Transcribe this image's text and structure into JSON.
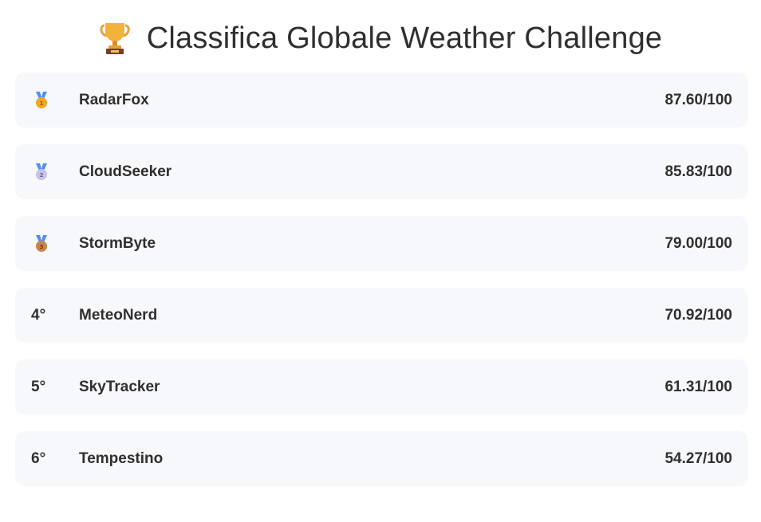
{
  "header": {
    "title": "Classifica Globale Weather Challenge",
    "icon": "trophy-icon"
  },
  "leaderboard": [
    {
      "rank": "",
      "medal": "gold",
      "name": "RadarFox",
      "score": "87.60/100"
    },
    {
      "rank": "",
      "medal": "silver",
      "name": "CloudSeeker",
      "score": "85.83/100"
    },
    {
      "rank": "",
      "medal": "bronze",
      "name": "StormByte",
      "score": "79.00/100"
    },
    {
      "rank": "4°",
      "medal": "",
      "name": "MeteoNerd",
      "score": "70.92/100"
    },
    {
      "rank": "5°",
      "medal": "",
      "name": "SkyTracker",
      "score": "61.31/100"
    },
    {
      "rank": "6°",
      "medal": "",
      "name": "Tempestino",
      "score": "54.27/100"
    }
  ],
  "colors": {
    "row_background": "#f7f8fb",
    "text": "#2f2f2f",
    "gold": "#f5a524",
    "silver": "#c9c2e6",
    "bronze": "#c8824e",
    "ribbon": "#4f8ef7"
  }
}
